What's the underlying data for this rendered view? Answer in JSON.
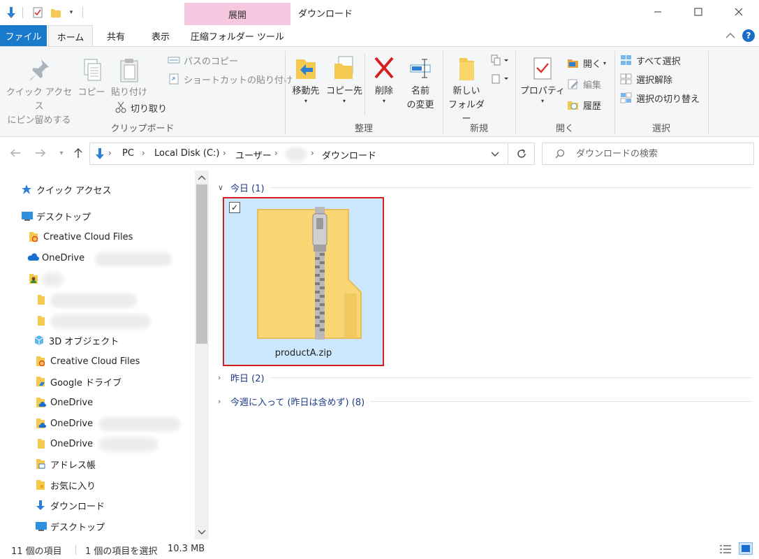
{
  "window": {
    "title": "ダウンロード",
    "context_tab_header": "展開"
  },
  "ribbon_tabs": [
    {
      "label": "ファイル"
    },
    {
      "label": "ホーム"
    },
    {
      "label": "共有"
    },
    {
      "label": "表示"
    },
    {
      "label": "圧縮フォルダー ツール"
    }
  ],
  "ribbon": {
    "clipboard": {
      "pin_line1": "クイック アクセス",
      "pin_line2": "にピン留めする",
      "copy": "コピー",
      "paste": "貼り付け",
      "copy_path": "パスのコピー",
      "paste_shortcut": "ショートカットの貼り付け",
      "cut": "切り取り",
      "group": "クリップボード"
    },
    "organize": {
      "move_to": "移動先",
      "copy_to": "コピー先",
      "delete": "削除",
      "rename_line1": "名前",
      "rename_line2": "の変更",
      "group": "整理"
    },
    "new": {
      "new_folder_line1": "新しい",
      "new_folder_line2": "フォルダー",
      "group": "新規"
    },
    "open": {
      "properties": "プロパティ",
      "open": "開く",
      "edit": "編集",
      "history": "履歴",
      "group": "開く"
    },
    "select": {
      "select_all": "すべて選択",
      "select_none": "選択解除",
      "invert": "選択の切り替え",
      "group": "選択"
    }
  },
  "address": {
    "crumbs": [
      "PC",
      "Local Disk (C:)",
      "ユーザー",
      "ダウンロード"
    ],
    "search_placeholder": "ダウンロードの検索"
  },
  "nav_pane": {
    "items": [
      {
        "label": "クイック アクセス",
        "icon": "star-icon"
      },
      {
        "label": "デスクトップ",
        "icon": "desktop-icon"
      },
      {
        "label": "Creative Cloud Files",
        "icon": "creative-cloud-folder-icon"
      },
      {
        "label": "OneDrive",
        "icon": "onedrive-cloud-icon"
      },
      {
        "label": "3D オブジェクト",
        "icon": "3d-objects-icon"
      },
      {
        "label": "Creative Cloud Files",
        "icon": "creative-cloud-folder-icon"
      },
      {
        "label": "Google ドライブ",
        "icon": "google-drive-folder-icon"
      },
      {
        "label": "OneDrive",
        "icon": "onedrive-folder-icon"
      },
      {
        "label": "OneDrive",
        "icon": "onedrive-folder-icon"
      },
      {
        "label": "OneDrive",
        "icon": "folder-icon"
      },
      {
        "label": "アドレス帳",
        "icon": "contacts-folder-icon"
      },
      {
        "label": "お気に入り",
        "icon": "favorites-folder-icon"
      },
      {
        "label": "ダウンロード",
        "icon": "download-arrow-icon"
      },
      {
        "label": "デスクトップ",
        "icon": "desktop-icon"
      }
    ]
  },
  "content": {
    "groups": [
      {
        "label": "今日 (1)",
        "expanded": true
      },
      {
        "label": "昨日 (2)",
        "expanded": false
      },
      {
        "label": "今週に入って (昨日は含めず) (8)",
        "expanded": false
      }
    ],
    "file": {
      "name": "productA.zip",
      "selected": true,
      "checked": true
    }
  },
  "status": {
    "item_count": "11 個の項目",
    "selection": "1 個の項目を選択",
    "size": "10.3 MB"
  },
  "colors": {
    "file_tab": "#1979ca",
    "context_tab": "#f7c6df",
    "selection": "#cce8ff",
    "highlight_border": "#d51f1f",
    "group_header": "#1e3b87"
  }
}
